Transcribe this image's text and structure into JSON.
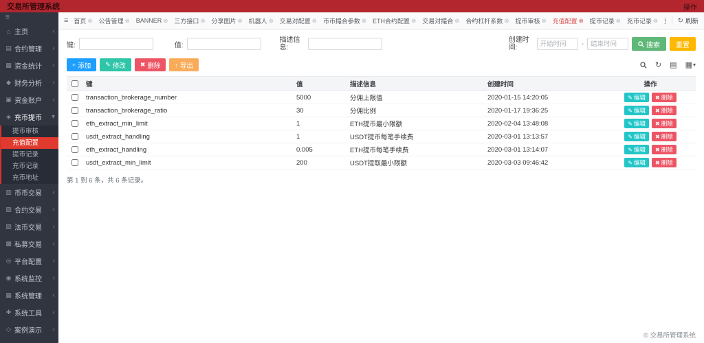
{
  "header": {
    "title": "交易所管理系统",
    "right_label": "操作"
  },
  "colors": {
    "header_bg": "#b4262e",
    "sidebar_bg": "#313540",
    "submenu_bg": "#282c36",
    "active_red": "#e0392e",
    "tab_active": "#d9534f",
    "accent_blue": "#1e9fff",
    "accent_teal": "#2ec5a8",
    "accent_teal2": "#23c6c8",
    "accent_red": "#ed5565",
    "accent_orange": "#f8ac59",
    "accent_orange2": "#ffb800",
    "accent_green": "#5fb878"
  },
  "icons": {
    "hamburger": "≡",
    "close_circle": "⊗",
    "refresh": "↻",
    "chevron_left": "‹",
    "chevron_down": "▾",
    "caret_down": "▾",
    "plus": "+",
    "pencil": "✎",
    "cross": "✖",
    "export": "↑",
    "toggle_view": "▤",
    "columns": "▦",
    "home": "⌂",
    "contract": "▤",
    "stats": "▦",
    "finance": "◆",
    "account": "▣",
    "coin": "◈",
    "trade": "▥",
    "contract_trade": "▧",
    "fiat": "▨",
    "private": "▩",
    "platform": "◎",
    "monitor": "◉",
    "system": "▦",
    "tools": "✚",
    "demo": "◇"
  },
  "sidebar": {
    "items": [
      {
        "label": "主页",
        "icon": "home"
      },
      {
        "label": "合约管理",
        "icon": "contract"
      },
      {
        "label": "资金统计",
        "icon": "stats"
      },
      {
        "label": "财务分析",
        "icon": "finance"
      },
      {
        "label": "资金账户",
        "icon": "account"
      },
      {
        "label": "充币提币",
        "icon": "coin",
        "expanded": true,
        "children": [
          "提币审核",
          "充值配置",
          "提币记录",
          "充币记录",
          "充币地址"
        ]
      },
      {
        "label": "币币交易",
        "icon": "trade"
      },
      {
        "label": "合约交易",
        "icon": "contract_trade"
      },
      {
        "label": "法币交易",
        "icon": "fiat"
      },
      {
        "label": "私募交易",
        "icon": "private"
      },
      {
        "label": "平台配置",
        "icon": "platform"
      },
      {
        "label": "系统监控",
        "icon": "monitor"
      },
      {
        "label": "系统管理",
        "icon": "system"
      },
      {
        "label": "系统工具",
        "icon": "tools"
      },
      {
        "label": "案例演示",
        "icon": "demo"
      }
    ],
    "active_child": "充值配置"
  },
  "tabbar": {
    "tabs": [
      "首页",
      "公告管理",
      "BANNER",
      "三方接口",
      "分享图片",
      "机器人",
      "交易对配置",
      "币币撮合参数",
      "ETH合约配置",
      "交易对撮合",
      "合约杠杆系数",
      "提币审核",
      "充值配置",
      "提币记录",
      "充币记录",
      "充币地址"
    ],
    "active": "充值配置",
    "refresh_label": "刷新"
  },
  "filters": {
    "key_label": "键:",
    "value_label": "值:",
    "desc_label": "描述信息:",
    "time_label": "创建时间:",
    "time_start_placeholder": "开始时间",
    "time_end_placeholder": "结束时间",
    "time_separator": "-",
    "search_label": "搜索",
    "reset_label": "重置"
  },
  "toolbar": {
    "add_label": "添加",
    "edit_label": "修改",
    "delete_label": "删除",
    "export_label": "导出"
  },
  "table": {
    "columns": [
      "键",
      "值",
      "描述信息",
      "创建时间",
      "操作"
    ],
    "rows": [
      {
        "key": "transaction_brokerage_number",
        "value": "5000",
        "desc": "分佣上限值",
        "time": "2020-01-15 14:20:05"
      },
      {
        "key": "transaction_brokerage_ratio",
        "value": "30",
        "desc": "分佣比例",
        "time": "2020-01-17 19:36:25"
      },
      {
        "key": "eth_extract_min_limit",
        "value": "1",
        "desc": "ETH提币最小限额",
        "time": "2020-02-04 13:48:08"
      },
      {
        "key": "usdt_extract_handling",
        "value": "1",
        "desc": "USDT提币每笔手续费",
        "time": "2020-03-01 13:13:57"
      },
      {
        "key": "eth_extract_handling",
        "value": "0.005",
        "desc": "ETH提币每笔手续费",
        "time": "2020-03-01 13:14:07"
      },
      {
        "key": "usdt_extract_min_limit",
        "value": "200",
        "desc": "USDT提取最小限额",
        "time": "2020-03-03 09:46:42"
      }
    ],
    "row_actions": {
      "edit": "编辑",
      "delete": "删除"
    },
    "summary": "第 1 到 6 条，共 6 条记录。"
  },
  "footer": {
    "copyright": "© 交易所管理系统"
  }
}
